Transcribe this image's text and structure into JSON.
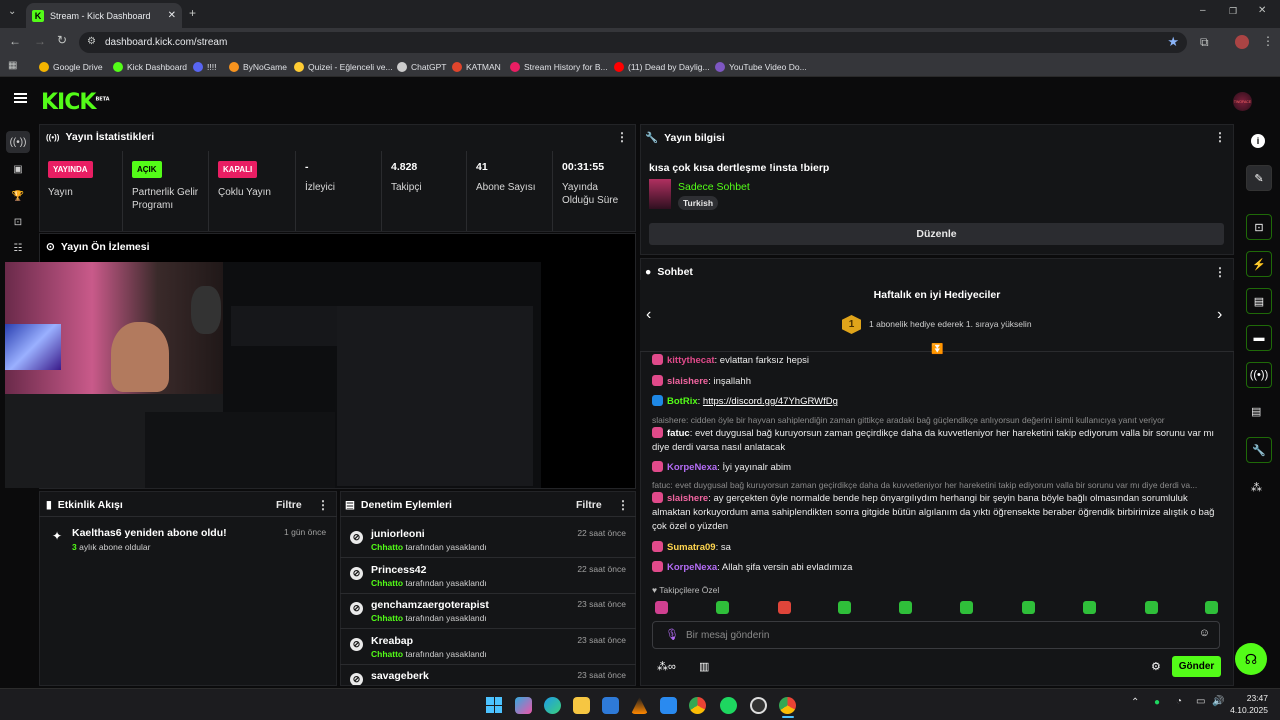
{
  "browser": {
    "tab_title": "Stream - Kick Dashboard",
    "url": "dashboard.kick.com/stream",
    "bookmarks": [
      {
        "label": "Google Drive",
        "color": "#f4b400"
      },
      {
        "label": "Kick Dashboard",
        "color": "#53fc18"
      },
      {
        "label": "!!!!",
        "color": "#5865f2"
      },
      {
        "label": "ByNoGame",
        "color": "#f7931e"
      },
      {
        "label": "Quizei - Eğlenceli ve...",
        "color": "#ffcc33"
      },
      {
        "label": "ChatGPT",
        "color": "#cccccc"
      },
      {
        "label": "KATMAN",
        "color": "#e0452c"
      },
      {
        "label": "Stream History for B...",
        "color": "#e91e63"
      },
      {
        "label": "(11) Dead by Daylig...",
        "color": "#ff0000"
      },
      {
        "label": "YouTube Video Do...",
        "color": "#7e57c2"
      }
    ]
  },
  "kick": {
    "logo": "KICK",
    "logo_sup": "BETA",
    "avatar_text": "TWOFACE"
  },
  "stats": {
    "title": "Yayın İstatistikleri",
    "items": [
      {
        "badge": "YAYINDA",
        "badge_color": "#e91e63",
        "label": "Yayın"
      },
      {
        "badge": "AÇIK",
        "badge_color": "#53fc18",
        "label": "Partnerlik Gelir Programı"
      },
      {
        "badge": "KAPALI",
        "badge_color": "#e91e63",
        "label": "Çoklu Yayın"
      },
      {
        "value": "-",
        "label": "İzleyici"
      },
      {
        "value": "4.828",
        "label": "Takipçi"
      },
      {
        "value": "41",
        "label": "Abone Sayısı"
      },
      {
        "value": "00:31:55",
        "label": "Yayında Olduğu Süre"
      }
    ]
  },
  "preview": {
    "title": "Yayın Ön İzlemesi"
  },
  "info": {
    "title": "Yayın bilgisi",
    "stream_title": "kısa çok kısa dertleşme !insta !bierp",
    "category": "Sadece Sohbet",
    "language": "Turkish",
    "edit_button": "Düzenle"
  },
  "chat": {
    "title": "Sohbet",
    "gifters_title": "Haftalık en iyi Hediyeciler",
    "gifters_rank": "1",
    "gifters_text": "1 abonelik hediye ederek 1. sıraya yükselin",
    "messages": [
      {
        "user": "kittythecat",
        "color": "#e04a8a",
        "text": ": evlattan farksız hepsi"
      },
      {
        "user": "slaishere",
        "color": "#f065a0",
        "text": ": inşallahh"
      },
      {
        "user": "BotRix",
        "color": "#53fc18",
        "text": ": ",
        "link": "https://discord.gg/47YhGRWfDg"
      },
      {
        "reply": "slaishere: cidden öyle bir hayvan sahiplendiğin zaman gittikçe aradaki bağ güçlendikçe anlıyorsun değerini isimli kullanıcıya yanıt veriyor"
      },
      {
        "user": "fatuc",
        "color": "#ffffff",
        "text": ": evet duygusal bağ kuruyorsun zaman geçirdikçe daha da kuvvetleniyor her hareketini takip ediyorum valla bir sorunu var mı diye derdi varsa nasıl anlatacak"
      },
      {
        "user": "KorpeNexa",
        "color": "#b46cf5",
        "text": ": İyi yayınalr abim"
      },
      {
        "reply": "fatuc: evet duygusal bağ kuruyorsun zaman geçirdikçe daha da kuvvetleniyor her hareketini takip ediyorum valla bir sorunu var mı diye derdi va..."
      },
      {
        "user": "slaishere",
        "color": "#f065a0",
        "text": ": ay gerçekten öyle normalde bende hep önyargılıydım herhangi bir şeyin bana böyle bağlı olmasından sorumluluk almaktan korkuyordum ama sahiplendikten sonra gitgide bütün algılanım da yıktı öğrensekte beraber öğrendik birbirimize alıştık o bağ çok özel o yüzden"
      },
      {
        "user": "Sumatra09",
        "color": "#ffd54f",
        "text": ": sa"
      },
      {
        "user": "KorpeNexa",
        "color": "#b46cf5",
        "text": ": Allah şifa versin abi evladımıza"
      }
    ],
    "followers_only": "Takipçilere Özel",
    "input_placeholder": "Bir mesaj gönderin",
    "send_button": "Gönder"
  },
  "activity": {
    "title": "Etkinlik Akışı",
    "filter": "Filtre",
    "items": [
      {
        "title": "Kaelthas6 yeniden abone oldu!",
        "months": "3",
        "sub": " aylık abone oldular",
        "time": "1 gün önce"
      }
    ]
  },
  "moderation": {
    "title": "Denetim Eylemleri",
    "filter": "Filtre",
    "items": [
      {
        "user": "juniorleoni",
        "by": "Chhatto",
        "action": " tarafından yasaklandı",
        "time": "22 saat önce"
      },
      {
        "user": "Princess42",
        "by": "Chhatto",
        "action": " tarafından yasaklandı",
        "time": "22 saat önce"
      },
      {
        "user": "genchamzaergoterapist",
        "by": "Chhatto",
        "action": " tarafından yasaklandı",
        "time": "23 saat önce"
      },
      {
        "user": "Kreabap",
        "by": "Chhatto",
        "action": " tarafından yasaklandı",
        "time": "23 saat önce"
      },
      {
        "user": "savageberk",
        "by": "",
        "action": "",
        "time": "23 saat önce"
      }
    ]
  },
  "taskbar": {
    "time": "23:47",
    "date": "4.10.2025"
  }
}
